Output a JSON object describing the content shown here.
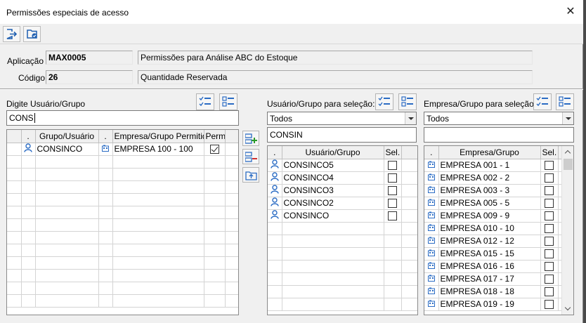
{
  "window": {
    "title": "Permissões especiais de acesso"
  },
  "toolbar": {
    "buttons": [
      "exit-icon",
      "save-check-icon"
    ]
  },
  "header": {
    "aplicacao_label": "Aplicação",
    "aplicacao_code": "MAX0005",
    "aplicacao_desc": "Permissões para Análise ABC do Estoque",
    "codigo_label": "Código",
    "codigo_code": "26",
    "codigo_desc": "Quantidade Reservada"
  },
  "left": {
    "label": "Digite Usuário/Grupo",
    "search_value": "CONS",
    "columns": [
      ".",
      "Grupo/Usuário",
      ".",
      "Empresa/Grupo Permitido",
      "Perm."
    ],
    "rows": [
      {
        "user": "CONSINCO",
        "empresa": "EMPRESA 100 - 100",
        "perm": true
      }
    ]
  },
  "middle": {
    "label": "Usuário/Grupo para seleção:",
    "select_value": "Todos",
    "search_value": "CONSIN",
    "columns": [
      ".",
      "Usuário/Grupo",
      "Sel."
    ],
    "rows": [
      {
        "name": "CONSINCO5",
        "sel": false
      },
      {
        "name": "CONSINCO4",
        "sel": false
      },
      {
        "name": "CONSINCO3",
        "sel": false
      },
      {
        "name": "CONSINCO2",
        "sel": false
      },
      {
        "name": "CONSINCO",
        "sel": false
      }
    ]
  },
  "right": {
    "label": "Empresa/Grupo para seleção:",
    "select_value": "Todos",
    "search_value": "",
    "columns": [
      ".",
      "Empresa/Grupo",
      "Sel."
    ],
    "rows": [
      {
        "name": "EMPRESA 001 - 1",
        "sel": false
      },
      {
        "name": "EMPRESA 002 - 2",
        "sel": false
      },
      {
        "name": "EMPRESA 003 - 3",
        "sel": false
      },
      {
        "name": "EMPRESA 005 - 5",
        "sel": false
      },
      {
        "name": "EMPRESA 009 - 9",
        "sel": false
      },
      {
        "name": "EMPRESA 010 - 10",
        "sel": false
      },
      {
        "name": "EMPRESA 012 - 12",
        "sel": false
      },
      {
        "name": "EMPRESA 015 - 15",
        "sel": false
      },
      {
        "name": "EMPRESA 016 - 16",
        "sel": false
      },
      {
        "name": "EMPRESA 017 - 17",
        "sel": false
      },
      {
        "name": "EMPRESA 018 - 18",
        "sel": false
      },
      {
        "name": "EMPRESA 019 - 19",
        "sel": false
      }
    ]
  },
  "colors": {
    "accent_blue": "#1f5fb0",
    "icon_blue": "#2b6cc4"
  }
}
